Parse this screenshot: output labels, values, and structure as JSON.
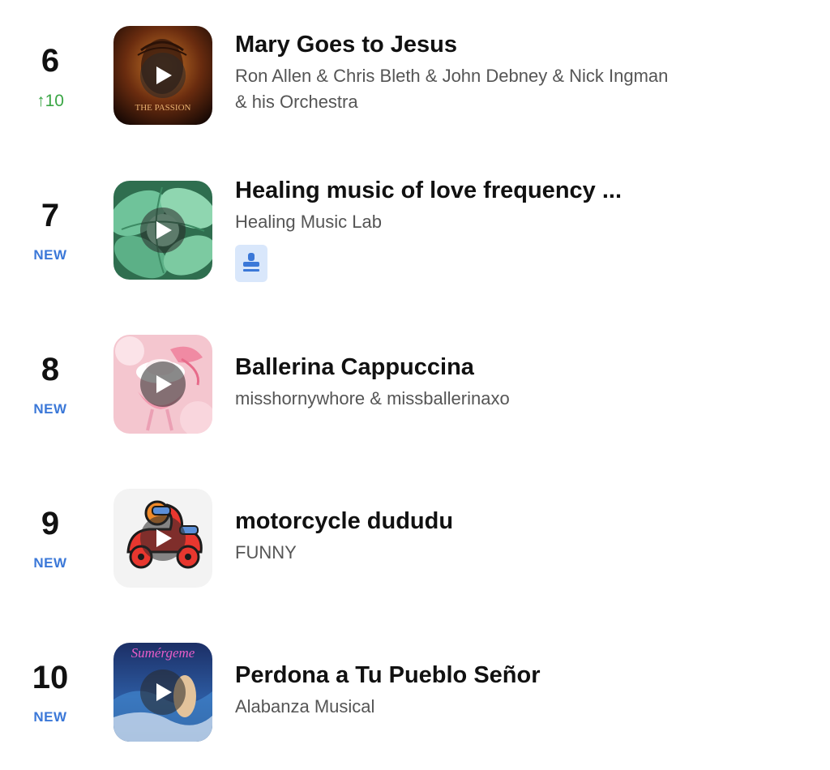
{
  "chart": {
    "entries": [
      {
        "rank": "6",
        "change": "↑10",
        "change_type": "up",
        "title": "Mary Goes to Jesus",
        "artist": "Ron Allen & Chris Bleth & John Debney & Nick Ingman & his Orchestra",
        "cover_text": "THE PASSION",
        "cover_icon": "passion-cover-art"
      },
      {
        "rank": "7",
        "change": "NEW",
        "change_type": "new",
        "title": "Healing music of love frequency ...",
        "artist": "Healing Music Lab",
        "badge_icon": "stamp-icon",
        "cover_icon": "green-flower-cover-art"
      },
      {
        "rank": "8",
        "change": "NEW",
        "change_type": "new",
        "title": "Ballerina Cappuccina",
        "artist": "misshornywhore & missballerinaxo",
        "cover_icon": "pink-ballerina-cover-art"
      },
      {
        "rank": "9",
        "change": "NEW",
        "change_type": "new",
        "title": "motorcycle dududu",
        "artist": "FUNNY",
        "cover_icon": "red-scooter-cover-art"
      },
      {
        "rank": "10",
        "change": "NEW",
        "change_type": "new",
        "title": "Perdona a Tu Pueblo Señor",
        "artist": "Alabanza Musical",
        "cover_text": "Sumérgeme",
        "cover_icon": "ocean-cover-art"
      }
    ]
  },
  "colors": {
    "new_badge": "#3b78d8",
    "rank_up": "#3aa645",
    "stamp_badge_bg": "#d9e7fb",
    "stamp_badge_fg": "#3b78d8"
  }
}
